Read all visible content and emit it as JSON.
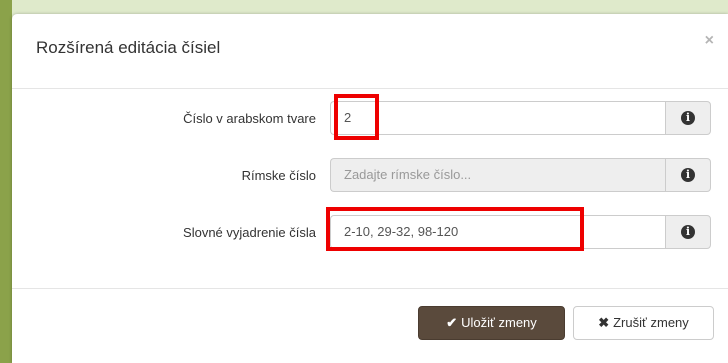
{
  "dialog": {
    "title": "Rozšírená editácia čísiel",
    "close_icon": "×"
  },
  "form": {
    "rows": [
      {
        "label": "Číslo v arabskom tvare",
        "value": "2",
        "placeholder": "",
        "disabled": false,
        "icon": "info-icon"
      },
      {
        "label": "Rímske číslo",
        "value": "",
        "placeholder": "Zadajte rímske číslo...",
        "disabled": true,
        "icon": "info-icon"
      },
      {
        "label": "Slovné vyjadrenie čísla",
        "value": "2-10, 29-32, 98-120",
        "placeholder": "",
        "disabled": false,
        "icon": "info-icon"
      }
    ],
    "info_glyph": "i"
  },
  "footer": {
    "save_label": "Uložiť zmeny",
    "save_icon": "✔",
    "cancel_label": "Zrušiť zmeny",
    "cancel_icon": "✖"
  },
  "colors": {
    "page_bg": "#dfeacb",
    "frame_border": "#8ba24a",
    "highlight": "#ee0000",
    "save_button": "#5a4a3c"
  }
}
